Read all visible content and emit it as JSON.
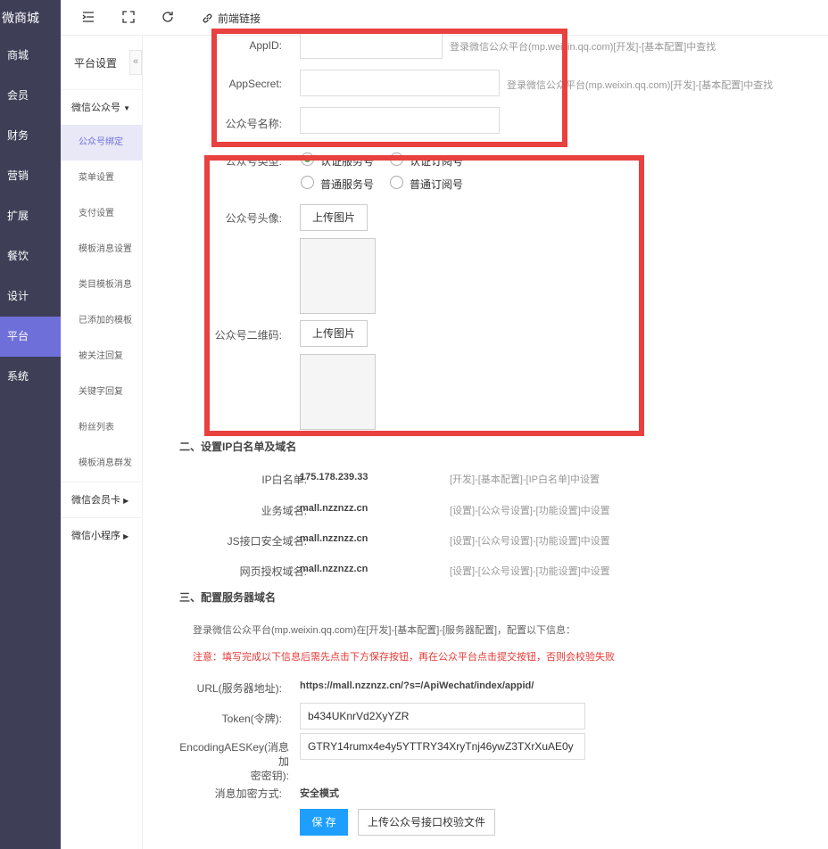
{
  "nav": {
    "brand": "微商城",
    "items": [
      "商城",
      "会员",
      "财务",
      "营销",
      "扩展",
      "餐饮",
      "设计",
      "平台",
      "系统"
    ]
  },
  "topbar": {
    "frontend_link": "前端链接"
  },
  "second_nav": {
    "title": "平台设置",
    "group_wechat": "微信公众号",
    "subs": [
      "公众号绑定",
      "菜单设置",
      "支付设置",
      "模板消息设置",
      "类目模板消息",
      "已添加的模板",
      "被关注回复",
      "关键字回复",
      "粉丝列表",
      "模板消息群发"
    ],
    "group_card": "微信会员卡",
    "group_mini": "微信小程序"
  },
  "form": {
    "appid_label": "AppID:",
    "appid_hint": "登录微信公众平台(mp.weixin.qq.com)[开发]-[基本配置]中查找",
    "appsecret_label": "AppSecret:",
    "appsecret_hint": "登录微信公众平台(mp.weixin.qq.com)[开发]-[基本配置]中查找",
    "name_label": "公众号名称:",
    "type_label": "公众号类型:",
    "types": [
      "认证服务号",
      "认证订阅号",
      "普通服务号",
      "普通订阅号"
    ],
    "avatar_label": "公众号头像:",
    "upload_label": "上传图片",
    "qrcode_label": "公众号二维码:"
  },
  "section2": {
    "title": "二、设置IP白名单及域名",
    "rows": [
      {
        "label": "IP白名单:",
        "value": "175.178.239.33",
        "note": "[开发]-[基本配置]-[IP白名单]中设置"
      },
      {
        "label": "业务域名:",
        "value": "mall.nzznzz.cn",
        "note": "[设置]-[公众号设置]-[功能设置]中设置"
      },
      {
        "label": "JS接口安全域名:",
        "value": "mall.nzznzz.cn",
        "note": "[设置]-[公众号设置]-[功能设置]中设置"
      },
      {
        "label": "网页授权域名:",
        "value": "mall.nzznzz.cn",
        "note": "[设置]-[公众号设置]-[功能设置]中设置"
      }
    ]
  },
  "section3": {
    "title": "三、配置服务器域名",
    "intro": "登录微信公众平台(mp.weixin.qq.com)在[开发]-[基本配置]-[服务器配置]，配置以下信息：",
    "warning": "注意：填写完成以下信息后需先点击下方保存按钮，再在公众平台点击提交按钮，否则会校验失败",
    "url_label": "URL(服务器地址):",
    "url_value": "https://mall.nzznzz.cn/?s=/ApiWechat/index/appid/",
    "token_label": "Token(令牌):",
    "token_value": "b434UKnrVd2XyYZR",
    "aes_label_1": "EncodingAESKey(消息加",
    "aes_label_2": "密密钥):",
    "aes_value": "GTRY14rumx4e4y5YTTRY34XryTnj46ywZ3TXrXuAE0y",
    "enc_label": "消息加密方式:",
    "enc_value": "安全模式",
    "save_label": "保 存",
    "upload_verify_label": "上传公众号接口校验文件"
  },
  "colors": {
    "sidebar": "#3e3e57",
    "accent": "#6f6fd9",
    "annotation": "#e8413f",
    "primary": "#1e9fff"
  }
}
